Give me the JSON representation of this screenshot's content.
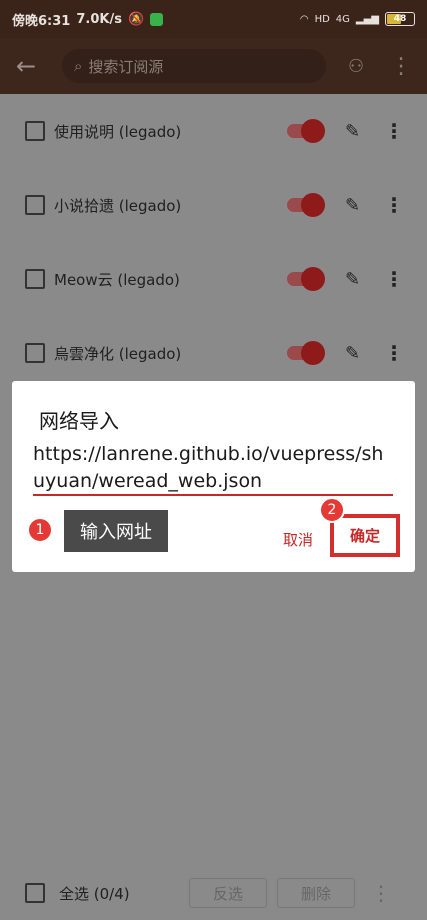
{
  "status_bar": {
    "time": "傍晚6:31",
    "speed": "7.0K/s",
    "network": "4G",
    "battery": "48"
  },
  "toolbar": {
    "back_icon": "arrow-left-icon",
    "search_placeholder": "搜索订阅源",
    "group_icon": "group-icon",
    "more_icon": "more-vertical-icon"
  },
  "list": {
    "items": [
      {
        "label": "使用说明 (legado)",
        "enabled": true
      },
      {
        "label": "小说拾遗 (legado)",
        "enabled": true
      },
      {
        "label": "Meow云 (legado)",
        "enabled": true
      },
      {
        "label": "烏雲净化 (legado)",
        "enabled": true
      }
    ]
  },
  "dialog": {
    "title": "网络导入",
    "url": "https://lanrene.github.io/vuepress/shuyuan/weread_web.json",
    "cancel": "取消",
    "confirm": "确定"
  },
  "annotations": {
    "step1": "1",
    "step1_label": "输入网址",
    "step2": "2"
  },
  "bottom_bar": {
    "select_all": "全选 (0/4)",
    "invert": "反选",
    "delete": "删除"
  },
  "colors": {
    "accent": "#c62828",
    "toolbar": "#3d271c",
    "overlay_bg": "#8a8a8a"
  }
}
